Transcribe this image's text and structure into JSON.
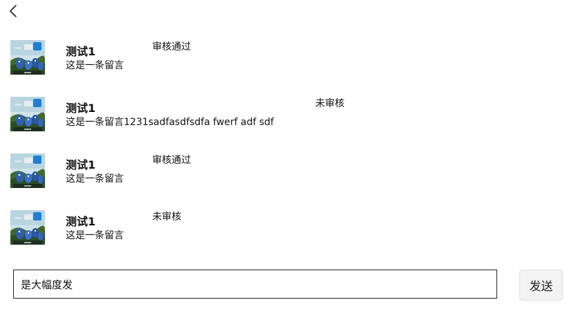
{
  "header": {
    "back_icon": "chevron-left-icon"
  },
  "comments": [
    {
      "author": "测试1",
      "status": "审核通过",
      "message": "这是一条留言"
    },
    {
      "author": "测试1",
      "status": "未审核",
      "message": "这是一条留言1231sadfasdfsdfa fwerf adf sdf"
    },
    {
      "author": "测试1",
      "status": "审核通过",
      "message": "这是一条留言"
    },
    {
      "author": "测试1",
      "status": "未审核",
      "message": "这是一条留言"
    }
  ],
  "composer": {
    "input_value": "是大幅度发",
    "send_label": "发送"
  }
}
